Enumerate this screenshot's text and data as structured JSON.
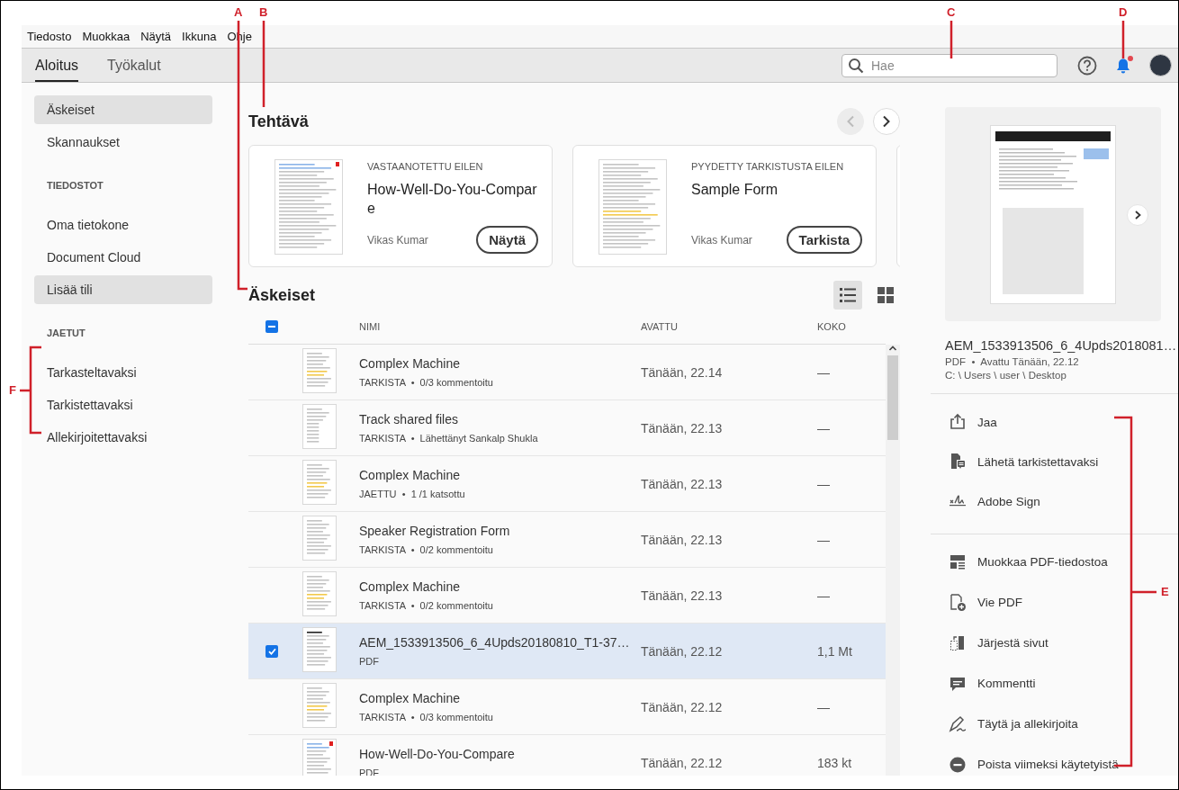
{
  "menu": [
    "Tiedosto",
    "Muokkaa",
    "Näytä",
    "Ikkuna",
    "Ohje"
  ],
  "tabs": [
    {
      "label": "Aloitus",
      "selected": true
    },
    {
      "label": "Työkalut",
      "selected": false
    }
  ],
  "search": {
    "placeholder": "Hae"
  },
  "notifications": {
    "unread": true
  },
  "sidebar": {
    "items": [
      {
        "kind": "item",
        "label": "Äskeiset",
        "selected": true
      },
      {
        "kind": "item",
        "label": "Skannaukset",
        "selected": false
      },
      {
        "kind": "header",
        "label": "TIEDOSTOT"
      },
      {
        "kind": "item",
        "label": "Oma tietokone",
        "selected": false
      },
      {
        "kind": "item",
        "label": "Document Cloud",
        "selected": false
      },
      {
        "kind": "button",
        "label": "Lisää tili"
      },
      {
        "kind": "header",
        "label": "JAETUT"
      },
      {
        "kind": "item",
        "label": "Tarkasteltavaksi",
        "selected": false
      },
      {
        "kind": "item",
        "label": "Tarkistettavaksi",
        "selected": false
      },
      {
        "kind": "item",
        "label": "Allekirjoitettavaksi",
        "selected": false
      }
    ]
  },
  "tasks": {
    "title": "Tehtävä",
    "prev": {
      "disabled": true
    },
    "next": {
      "disabled": false
    },
    "cards": [
      {
        "label": "VASTAANOTETTU EILEN",
        "title": "How-Well-Do-You-Compare",
        "owner": "Vikas Kumar",
        "action": "Näytä"
      },
      {
        "label": "PYYDETTY TARKISTUSTA EILEN",
        "title": "Sample Form",
        "owner": "Vikas Kumar",
        "action": "Tarkista"
      }
    ]
  },
  "recent": {
    "title": "Äskeiset",
    "select_all_partial": true,
    "views": [
      {
        "kind": "list",
        "selected": true
      },
      {
        "kind": "grid",
        "selected": false
      }
    ],
    "columns": [
      "NIMI",
      "AVATTU",
      "KOKO"
    ],
    "rows": [
      {
        "name": "Complex Machine",
        "subtitle": "TARKISTA  •  0/3 kommentoitu",
        "opened": "Tänään, 22.14",
        "size": "—",
        "selected": false
      },
      {
        "name": "Track shared files",
        "subtitle": "TARKISTA  •  Lähettänyt Sankalp Shukla",
        "opened": "Tänään, 22.13",
        "size": "—",
        "selected": false
      },
      {
        "name": "Complex Machine",
        "subtitle": "JAETTU  •  1 /1 katsottu",
        "opened": "Tänään, 22.13",
        "size": "—",
        "selected": false
      },
      {
        "name": "Speaker Registration Form",
        "subtitle": "TARKISTA  •  0/2 kommentoitu",
        "opened": "Tänään, 22.13",
        "size": "—",
        "selected": false
      },
      {
        "name": "Complex Machine",
        "subtitle": "TARKISTA  •  0/2 kommentoitu",
        "opened": "Tänään, 22.13",
        "size": "—",
        "selected": false
      },
      {
        "name": "AEM_1533913506_6_4Upds20180810_T1-37…",
        "subtitle": "PDF",
        "opened": "Tänään, 22.12",
        "size": "1,1 Mt",
        "selected": true
      },
      {
        "name": "Complex Machine",
        "subtitle": "TARKISTA  •  0/3 kommentoitu",
        "opened": "Tänään, 22.12",
        "size": "—",
        "selected": false
      },
      {
        "name": "How-Well-Do-You-Compare",
        "subtitle": "PDF",
        "opened": "Tänään, 22.12",
        "size": "183 kt",
        "selected": false
      }
    ]
  },
  "details": {
    "name": "AEM_1533913506_6_4Upds2018081…",
    "meta": "PDF  •  Avattu Tänään, 22.12",
    "path": "C: \\ Users \\ user \\ Desktop",
    "action_groups": [
      [
        "Jaa",
        "Lähetä tarkistettavaksi",
        "Adobe Sign"
      ],
      [
        "Muokkaa PDF-tiedostoa",
        "Vie PDF",
        "Järjestä sivut",
        "Kommentti",
        "Täytä ja allekirjoita",
        "Poista viimeksi käytetyistä"
      ]
    ]
  },
  "callouts": [
    {
      "label": "A"
    },
    {
      "label": "B"
    },
    {
      "label": "C"
    },
    {
      "label": "D"
    },
    {
      "label": "E"
    },
    {
      "label": "F"
    }
  ]
}
